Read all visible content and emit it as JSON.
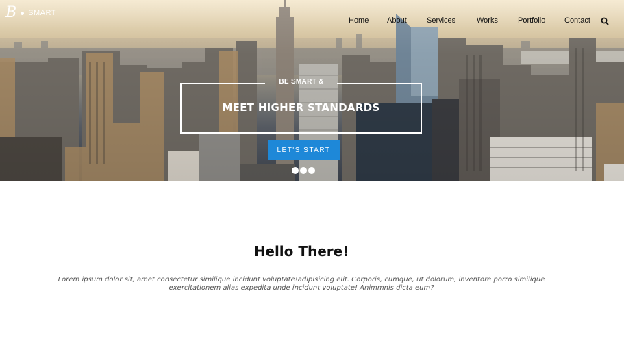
{
  "brand": {
    "mark": "B",
    "name": "SMART"
  },
  "nav": {
    "items": [
      {
        "label": "Home"
      },
      {
        "label": "About"
      },
      {
        "label": "Services"
      },
      {
        "label": "Works"
      },
      {
        "label": "Portfolio"
      },
      {
        "label": "Contact"
      }
    ],
    "search_icon": "search-icon"
  },
  "hero": {
    "eyebrow": "BE SMART &",
    "headline": "MEET HIGHER STANDARDS",
    "cta_label": "LET'S START",
    "slides_count": 3,
    "accent_color": "#1e88d8"
  },
  "intro": {
    "title": "Hello There!",
    "body": "Lorem ipsum dolor sit, amet consectetur similique incidunt voluptate!adipisicing elit. Corporis, cumque, ut dolorum, inventore porro similique exercitationem alias expedita unde incidunt voluptate! Animmnis dicta eum?"
  }
}
